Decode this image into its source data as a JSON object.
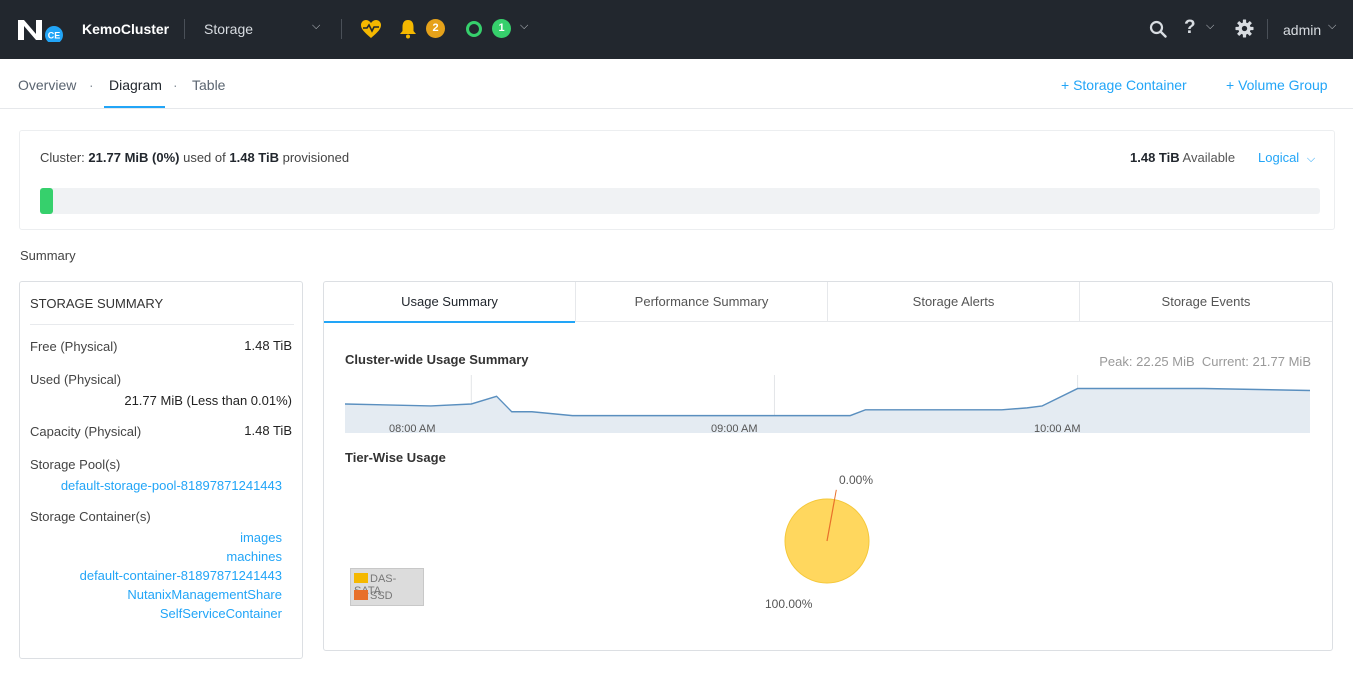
{
  "topbar": {
    "logo_badge": "CE",
    "cluster_name": "KemoCluster",
    "section": "Storage",
    "alerts_count": "2",
    "tasks_count": "1",
    "help_label": "?",
    "user": "admin",
    "icons": {
      "logo": "nutanix-logo",
      "section": "chevron-down-icon",
      "health": "heart-pulse-icon",
      "alerts": "bell-icon",
      "tasks": "ring-icon",
      "search": "search-icon",
      "settings": "gear-icon"
    },
    "colors": {
      "background": "#22272e",
      "health": "#f5b800",
      "alert_badge": "#e6a21a",
      "task_badge": "#36d06c"
    }
  },
  "subnav": {
    "tabs": [
      {
        "label": "Overview",
        "active": false
      },
      {
        "label": "Diagram",
        "active": true
      },
      {
        "label": "Table",
        "active": false
      }
    ],
    "separator": "·",
    "actions": [
      {
        "label": "+ Storage Container"
      },
      {
        "label": "+ Volume Group"
      }
    ]
  },
  "cluster_usage": {
    "prefix": "Cluster:",
    "used": "21.77 MiB (0%)",
    "used_of": "used of",
    "provisioned_total": "1.48 TiB",
    "provisioned_label": "provisioned",
    "available_value": "1.48 TiB",
    "available_label": "Available",
    "view_mode": "Logical",
    "bar_fraction": 0.01,
    "bar_color": "#36d06c"
  },
  "summary_label": "Summary",
  "storage_summary": {
    "title": "STORAGE SUMMARY",
    "rows": [
      {
        "label": "Free (Physical)",
        "value": "1.48 TiB"
      },
      {
        "label": "Used (Physical)",
        "value": "21.77 MiB (Less than 0.01%)"
      },
      {
        "label": "Capacity (Physical)",
        "value": "1.48 TiB"
      }
    ],
    "pools_label": "Storage Pool(s)",
    "pools": [
      "default-storage-pool-81897871241443"
    ],
    "containers_label": "Storage Container(s)",
    "containers": [
      "images",
      "machines",
      "default-container-81897871241443",
      "NutanixManagementShare",
      "SelfServiceContainer"
    ]
  },
  "right_panel": {
    "tabs": [
      {
        "label": "Usage Summary",
        "active": true
      },
      {
        "label": "Performance Summary",
        "active": false
      },
      {
        "label": "Storage Alerts",
        "active": false
      },
      {
        "label": "Storage Events",
        "active": false
      }
    ],
    "usage_chart": {
      "title": "Cluster-wide Usage Summary",
      "peak_label": "Peak: 22.25 MiB",
      "current_label": "Current: 21.77 MiB"
    },
    "tier_title": "Tier-Wise Usage",
    "legend": [
      {
        "name": "DAS-SATA",
        "color": "#f5b800"
      },
      {
        "name": "SSD",
        "color": "#e8702a"
      }
    ]
  },
  "chart_data": [
    {
      "type": "area",
      "title": "Cluster-wide Usage Summary",
      "x_ticks": [
        "08:00 AM",
        "09:00 AM",
        "10:00 AM"
      ],
      "unit": "MiB",
      "peak": 22.25,
      "current": 21.77,
      "x": [
        "07:35",
        "07:52",
        "08:00",
        "08:05",
        "08:08",
        "08:12",
        "08:20",
        "08:40",
        "09:05",
        "09:15",
        "09:18",
        "09:45",
        "09:50",
        "09:53",
        "10:00",
        "10:25",
        "10:46"
      ],
      "values": [
        21.7,
        21.69,
        21.7,
        21.74,
        21.66,
        21.66,
        21.64,
        21.64,
        21.64,
        21.64,
        21.67,
        21.67,
        21.68,
        21.69,
        21.78,
        21.78,
        21.77
      ],
      "grid": true
    },
    {
      "type": "pie",
      "title": "Tier-Wise Usage",
      "series": [
        {
          "name": "DAS-SATA",
          "value": 100.0,
          "label": "100.00%",
          "color": "#f5b800"
        },
        {
          "name": "SSD",
          "value": 0.0,
          "label": "0.00%",
          "color": "#e8702a"
        }
      ],
      "legend": "bottom-left"
    }
  ]
}
